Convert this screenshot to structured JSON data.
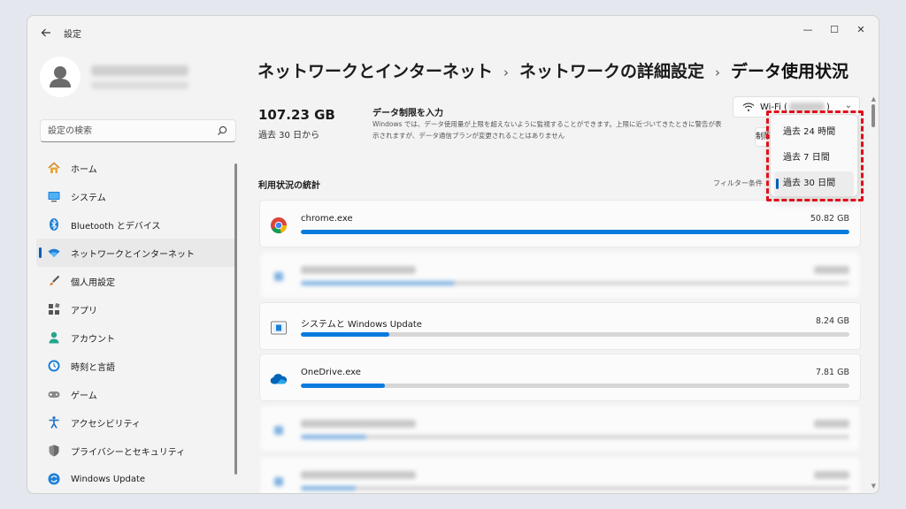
{
  "window": {
    "title": "設定",
    "controls": {
      "minimize": "—",
      "maximize": "☐",
      "close": "✕"
    }
  },
  "sidebar": {
    "search": {
      "placeholder": "設定の検索"
    },
    "items": [
      {
        "label": "ホーム",
        "icon": "home-icon",
        "active": false
      },
      {
        "label": "システム",
        "icon": "system-icon",
        "active": false
      },
      {
        "label": "Bluetooth とデバイス",
        "icon": "bluetooth-icon",
        "active": false
      },
      {
        "label": "ネットワークとインターネット",
        "icon": "wifi-icon",
        "active": true
      },
      {
        "label": "個人用設定",
        "icon": "brush-icon",
        "active": false
      },
      {
        "label": "アプリ",
        "icon": "apps-icon",
        "active": false
      },
      {
        "label": "アカウント",
        "icon": "account-icon",
        "active": false
      },
      {
        "label": "時刻と言語",
        "icon": "globe-clock-icon",
        "active": false
      },
      {
        "label": "ゲーム",
        "icon": "gamepad-icon",
        "active": false
      },
      {
        "label": "アクセシビリティ",
        "icon": "accessibility-icon",
        "active": false
      },
      {
        "label": "プライバシーとセキュリティ",
        "icon": "shield-icon",
        "active": false
      },
      {
        "label": "Windows Update",
        "icon": "update-icon",
        "active": false
      }
    ]
  },
  "breadcrumb": {
    "level1": "ネットワークとインターネット",
    "level2": "ネットワークの詳細設定",
    "current": "データ使用状況",
    "separator": "›"
  },
  "usage": {
    "total": "107.23 GB",
    "period": "過去 30 日から"
  },
  "data_limit": {
    "title": "データ制限を入力",
    "description": "Windows では、データ使用量が上限を超えないように監視することができます。上限に近づいてきたときに警告が表示されますが、データ通信プランが変更されることはありません",
    "button_label": "制限"
  },
  "network_select": {
    "prefix": "Wi-Fi (",
    "suffix": ")"
  },
  "stats": {
    "title": "利用状況の統計",
    "filter_label": "フィルター条件"
  },
  "apps": [
    {
      "name": "chrome.exe",
      "size": "50.82 GB",
      "fraction": 1.0,
      "icon": "chrome-icon",
      "blurred": false
    },
    {
      "name": "",
      "size": "",
      "fraction": 0.28,
      "icon": "app-icon",
      "blurred": true
    },
    {
      "name": "システムと Windows Update",
      "size": "8.24 GB",
      "fraction": 0.162,
      "icon": "windows-update-app-icon",
      "blurred": false
    },
    {
      "name": "OneDrive.exe",
      "size": "7.81 GB",
      "fraction": 0.154,
      "icon": "onedrive-icon",
      "blurred": false
    },
    {
      "name": "",
      "size": "",
      "fraction": 0.12,
      "icon": "app-icon",
      "blurred": true
    },
    {
      "name": "",
      "size": "",
      "fraction": 0.1,
      "icon": "app-icon",
      "blurred": true
    }
  ],
  "period_menu": {
    "options": [
      {
        "label": "過去 24 時間",
        "selected": false
      },
      {
        "label": "過去 7 日間",
        "selected": false
      },
      {
        "label": "過去 30 日間",
        "selected": true
      }
    ]
  },
  "colors": {
    "accent": "#005fb8",
    "bar": "#0a7bde",
    "highlight": "#e0101c"
  }
}
